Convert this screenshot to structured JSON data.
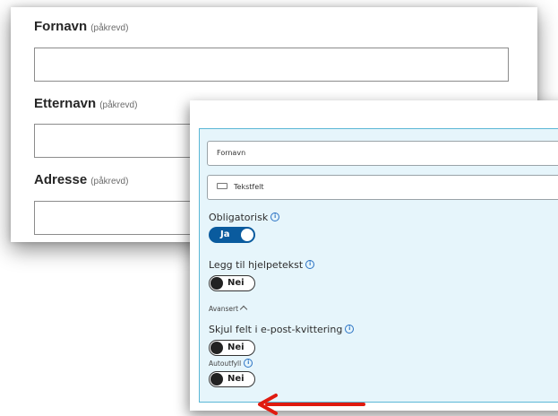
{
  "form": {
    "fields": [
      {
        "label": "Fornavn",
        "required_hint": "(påkrevd)",
        "value": ""
      },
      {
        "label": "Etternavn",
        "required_hint": "(påkrevd)",
        "value": ""
      },
      {
        "label": "Adresse",
        "required_hint": "(påkrevd)",
        "value": ""
      }
    ]
  },
  "settings": {
    "field_name": "Fornavn",
    "field_type": "Tekstfelt",
    "required_label": "Obligatorisk",
    "required_toggle": "Ja",
    "helptext_label": "Legg til hjelpetekst",
    "helptext_toggle": "Nei",
    "advanced_label": "Avansert",
    "hide_receipt_label": "Skjul felt i e-post-kvittering",
    "hide_receipt_toggle": "Nei",
    "autofill_label": "Autoutfyll",
    "autofill_toggle": "Nei"
  },
  "colors": {
    "accent": "#0a5b9e",
    "panel_background": "#e6f5fb",
    "panel_border": "#5bb7d6",
    "annotation_arrow": "#e01b10"
  },
  "icons": {
    "info": "info-icon",
    "field_type": "text-field-icon",
    "advanced_toggle": "chevron-up-icon",
    "annotation": "red-arrow-left-icon"
  }
}
